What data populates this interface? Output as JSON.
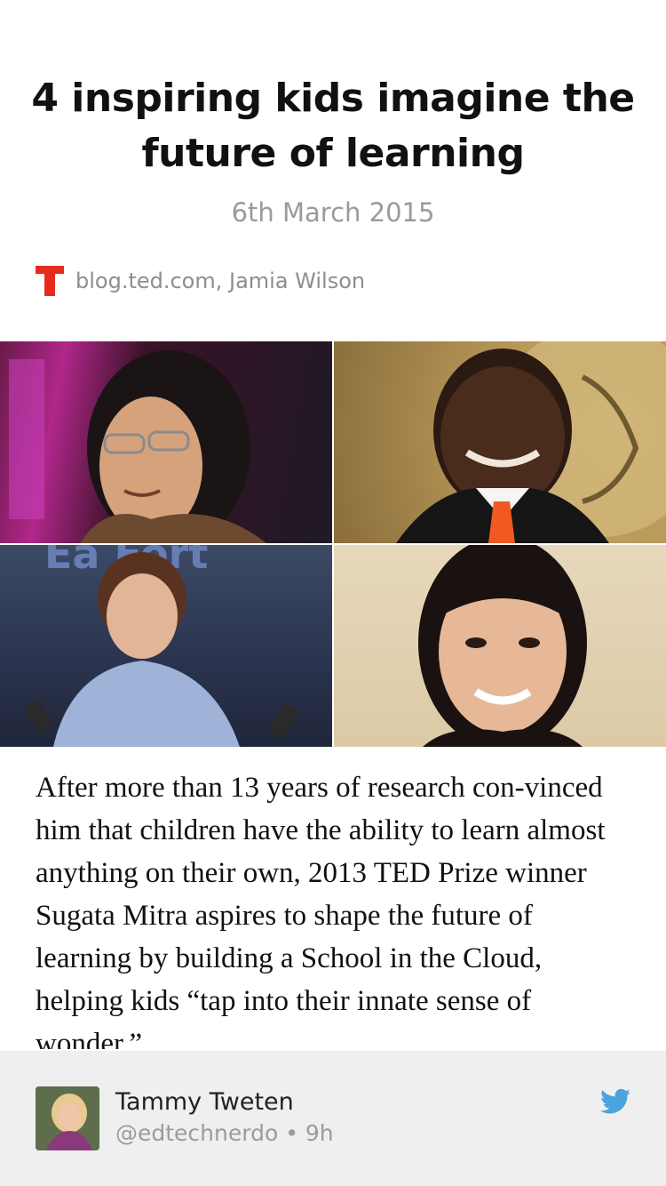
{
  "article": {
    "headline": "4 inspiring kids imagine the future of learning",
    "date": "6th March 2015",
    "source": "blog.ted.com, Jamia Wilson",
    "source_icon": "ted-logo-icon",
    "body": "After more than 13 years of research con-vinced him that children have the ability to learn almost anything on their own, 2013 TED Prize winner Sugata Mitra aspires to shape the future of learning by building a School in the Cloud, helping kids “tap into their innate sense of wonder.”"
  },
  "footer": {
    "author_name": "Tammy Tweten",
    "author_meta": "@edtechnerdo • 9h",
    "service_icon": "twitter-icon"
  },
  "colors": {
    "ted_red": "#e62b1e",
    "twitter_blue": "#4aa3df",
    "footer_bg": "#efefef"
  }
}
